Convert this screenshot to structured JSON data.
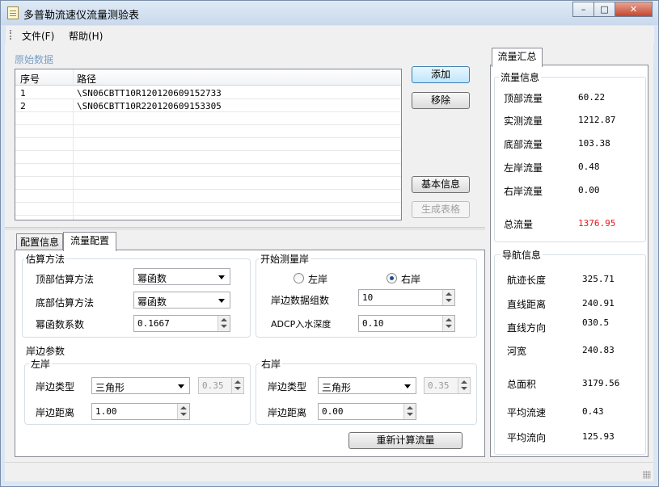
{
  "window": {
    "title": "多普勒流速仪流量测验表",
    "controls": {
      "minimize": "–",
      "maximize": "□",
      "close": "✕"
    }
  },
  "menu": {
    "file": "文件(F)",
    "help": "帮助(H)"
  },
  "raw_data": {
    "caption": "原始数据",
    "columns": [
      "序号",
      "路径"
    ],
    "rows": [
      {
        "index": "1",
        "path": "\\SN06CBTT10R120120609152733"
      },
      {
        "index": "2",
        "path": "\\SN06CBTT10R220120609153305"
      }
    ],
    "buttons": {
      "add": "添加",
      "remove": "移除",
      "basic_info": "基本信息",
      "generate_table": "生成表格"
    }
  },
  "tabs": {
    "config_info": "配置信息",
    "flow_config": "流量配置"
  },
  "estimation": {
    "caption": "估算方法",
    "top_label": "顶部估算方法",
    "top_value": "幂函数",
    "bottom_label": "底部估算方法",
    "bottom_value": "幂函数",
    "coef_label": "幂函数系数",
    "coef_value": "0.1667"
  },
  "start_bank": {
    "caption": "开始测量岸",
    "left": "左岸",
    "right": "右岸",
    "selected": "right",
    "groups_label": "岸边数据组数",
    "groups_value": "10",
    "adcp_label": "ADCP入水深度",
    "adcp_value": "0.10"
  },
  "bank_params": {
    "caption": "岸边参数",
    "left": {
      "caption": "左岸",
      "type_label": "岸边类型",
      "type_value": "三角形",
      "coef_value": "0.35",
      "dist_label": "岸边距离",
      "dist_value": "1.00"
    },
    "right": {
      "caption": "右岸",
      "type_label": "岸边类型",
      "type_value": "三角形",
      "coef_value": "0.35",
      "dist_label": "岸边距离",
      "dist_value": "0.00"
    }
  },
  "recalc_button": "重新计算流量",
  "summary": {
    "tab": "流量汇总",
    "flow_caption": "流量信息",
    "flow": [
      {
        "label": "顶部流量",
        "value": "60.22"
      },
      {
        "label": "实测流量",
        "value": "1212.87"
      },
      {
        "label": "底部流量",
        "value": "103.38"
      },
      {
        "label": "左岸流量",
        "value": "0.48"
      },
      {
        "label": "右岸流量",
        "value": "0.00"
      }
    ],
    "total_label": "总流量",
    "total_value": "1376.95",
    "total_color": "#e8141c",
    "nav_caption": "导航信息",
    "nav": [
      {
        "label": "航迹长度",
        "value": "325.71"
      },
      {
        "label": "直线距离",
        "value": "240.91"
      },
      {
        "label": "直线方向",
        "value": "030.5"
      },
      {
        "label": "河宽",
        "value": "240.83"
      },
      {
        "label": "总面积",
        "value": "3179.56"
      },
      {
        "label": "平均流速",
        "value": "0.43"
      },
      {
        "label": "平均流向",
        "value": "125.93"
      }
    ]
  }
}
